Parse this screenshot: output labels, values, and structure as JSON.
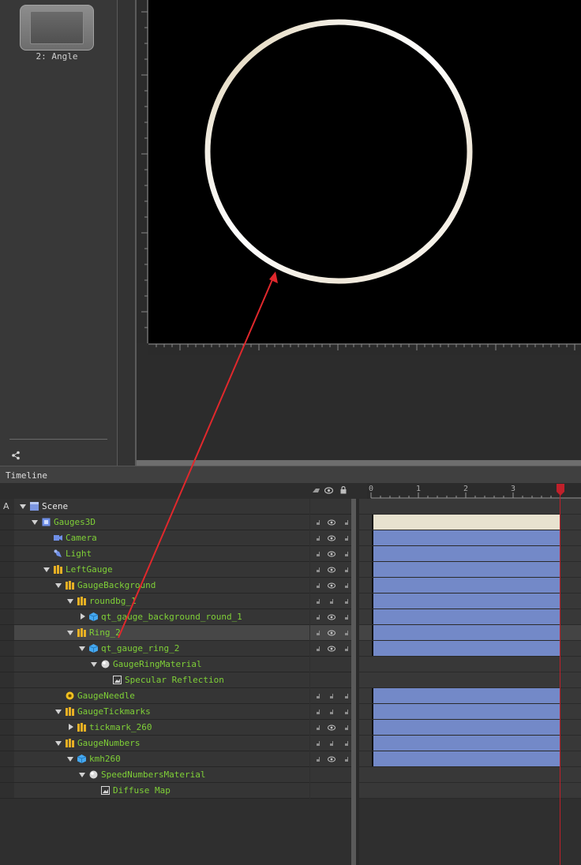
{
  "slides": {
    "slide_label": "2: Angle"
  },
  "timeline": {
    "title": "Timeline",
    "margin_marker": "A",
    "time_ticks": [
      "0",
      "1",
      "2",
      "3"
    ],
    "rows": [
      {
        "label": "Scene",
        "icon": "scene-icon",
        "indent": 0,
        "arrow": "down",
        "color": "white",
        "bar": "scene",
        "controls": [],
        "selected": false
      },
      {
        "label": "Gauges3D",
        "icon": "layer-icon",
        "indent": 1,
        "arrow": "down",
        "color": "green",
        "bar": "scene",
        "controls": [
          "lock",
          "eye",
          "lock"
        ],
        "selected": false
      },
      {
        "label": "Camera",
        "icon": "camera-icon",
        "indent": 2,
        "arrow": "",
        "color": "green",
        "bar": "blue",
        "controls": [
          "lock",
          "eye",
          "lock"
        ],
        "selected": false
      },
      {
        "label": "Light",
        "icon": "light-icon",
        "indent": 2,
        "arrow": "",
        "color": "green",
        "bar": "blue",
        "controls": [
          "lock",
          "eye",
          "lock"
        ],
        "selected": false
      },
      {
        "label": "LeftGauge",
        "icon": "group-icon",
        "indent": 2,
        "arrow": "down",
        "color": "green",
        "bar": "blue",
        "controls": [
          "lock",
          "eye",
          "lock"
        ],
        "selected": false
      },
      {
        "label": "GaugeBackground",
        "icon": "group-icon",
        "indent": 3,
        "arrow": "down",
        "color": "green",
        "bar": "blue",
        "controls": [
          "lock",
          "eye",
          "lock"
        ],
        "selected": false
      },
      {
        "label": "roundbg_1",
        "icon": "group-icon",
        "indent": 4,
        "arrow": "down",
        "color": "green",
        "bar": "blue",
        "controls": [
          "lock",
          "lock",
          "lock"
        ],
        "selected": false
      },
      {
        "label": "qt_gauge_background_round_1",
        "icon": "model-icon",
        "indent": 5,
        "arrow": "right",
        "color": "green",
        "bar": "blue",
        "controls": [
          "lock",
          "eye",
          "lock"
        ],
        "selected": false
      },
      {
        "label": "Ring_2",
        "icon": "group-icon",
        "indent": 4,
        "arrow": "down",
        "color": "green",
        "bar": "blue",
        "controls": [
          "lock",
          "eye",
          "lock"
        ],
        "selected": true
      },
      {
        "label": "qt_gauge_ring_2",
        "icon": "model-icon",
        "indent": 5,
        "arrow": "down",
        "color": "green",
        "bar": "blue",
        "controls": [
          "lock",
          "eye",
          "lock"
        ],
        "selected": false
      },
      {
        "label": "GaugeRingMaterial",
        "icon": "material-icon",
        "indent": 6,
        "arrow": "down",
        "color": "green",
        "bar": "none",
        "controls": [],
        "selected": false
      },
      {
        "label": "Specular Reflection",
        "icon": "image-icon",
        "indent": 7,
        "arrow": "",
        "color": "green",
        "bar": "none",
        "controls": [],
        "selected": false
      },
      {
        "label": "GaugeNeedle",
        "icon": "component-icon",
        "indent": 3,
        "arrow": "",
        "color": "green",
        "bar": "blue",
        "controls": [
          "lock",
          "lock",
          "lock"
        ],
        "selected": false
      },
      {
        "label": "GaugeTickmarks",
        "icon": "group-icon",
        "indent": 3,
        "arrow": "down",
        "color": "green",
        "bar": "blue",
        "controls": [
          "lock",
          "lock",
          "lock"
        ],
        "selected": false
      },
      {
        "label": "tickmark_260",
        "icon": "group-icon",
        "indent": 4,
        "arrow": "right",
        "color": "green",
        "bar": "blue",
        "controls": [
          "lock",
          "eye",
          "lock"
        ],
        "selected": false
      },
      {
        "label": "GaugeNumbers",
        "icon": "group-icon",
        "indent": 3,
        "arrow": "down",
        "color": "green",
        "bar": "blue",
        "controls": [
          "lock",
          "lock",
          "lock"
        ],
        "selected": false
      },
      {
        "label": "kmh260",
        "icon": "model-icon",
        "indent": 4,
        "arrow": "down",
        "color": "green",
        "bar": "blue",
        "controls": [
          "lock",
          "eye",
          "lock"
        ],
        "selected": false
      },
      {
        "label": "SpeedNumbersMaterial",
        "icon": "material-icon",
        "indent": 5,
        "arrow": "down",
        "color": "green",
        "bar": "none",
        "controls": [],
        "selected": false
      },
      {
        "label": "Diffuse Map",
        "icon": "image-icon",
        "indent": 6,
        "arrow": "",
        "color": "green",
        "bar": "none",
        "controls": [],
        "selected": false
      }
    ]
  },
  "colors": {
    "label_green": "#7fd037",
    "track_blue": "#7389c8",
    "scene_bar": "#e8e2cf",
    "playhead_red": "#c0202a",
    "annotation_red": "#e0282c"
  }
}
